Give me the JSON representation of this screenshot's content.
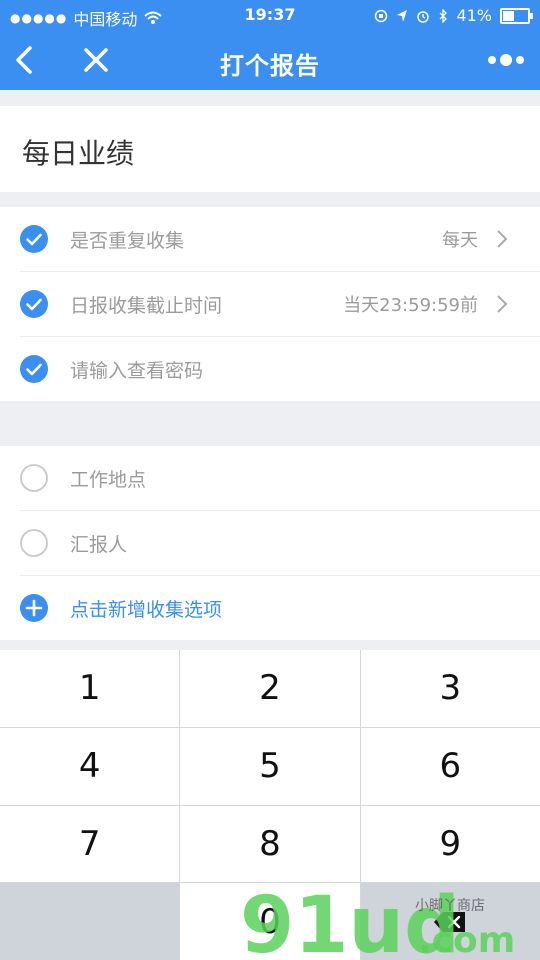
{
  "status_bar": {
    "carrier": "中国移动",
    "time": "19:37",
    "battery_percent": "41%"
  },
  "nav": {
    "title": "打个报告"
  },
  "report": {
    "title": "每日业绩"
  },
  "settings": [
    {
      "label": "是否重复收集",
      "value": "每天",
      "checked": true,
      "chevron": true
    },
    {
      "label": "日报收集截止时间",
      "value": "当天23:59:59前",
      "checked": true,
      "chevron": true
    },
    {
      "label": "请输入查看密码",
      "value": "",
      "checked": true,
      "chevron": false
    }
  ],
  "fields": [
    {
      "label": "工作地点"
    },
    {
      "label": "汇报人"
    }
  ],
  "add_field_label": "点击新增收集选项",
  "keypad": [
    "1",
    "2",
    "3",
    "4",
    "5",
    "6",
    "7",
    "8",
    "9",
    "",
    "0",
    ""
  ],
  "watermark": {
    "brand": "91ud",
    "domain": ".com",
    "slogan": "小脚丫商店"
  },
  "colors": {
    "accent": "#3b8ff0"
  }
}
